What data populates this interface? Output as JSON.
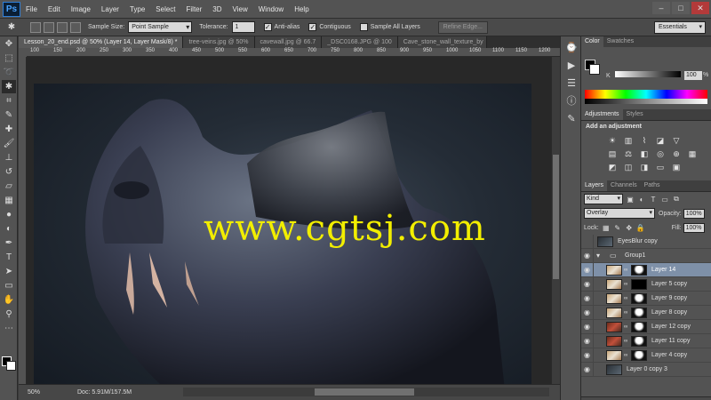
{
  "app": {
    "logo": "Ps"
  },
  "menu": [
    "File",
    "Edit",
    "Image",
    "Layer",
    "Type",
    "Select",
    "Filter",
    "3D",
    "View",
    "Window",
    "Help"
  ],
  "window_controls": [
    "–",
    "□",
    "✕"
  ],
  "options": {
    "sample_size_label": "Sample Size:",
    "sample_size_value": "Point Sample",
    "tolerance_label": "Tolerance:",
    "tolerance_value": "1",
    "anti_alias_label": "Anti-alias",
    "contiguous_label": "Contiguous",
    "sample_all_label": "Sample All Layers",
    "refine_edge_label": "Refine Edge...",
    "workspace_value": "Essentials"
  },
  "doc_tabs": [
    "Lesson_20_end.psd @ 50% (Layer 14, Layer Mask/8) *",
    "tree-veins.jpg @ 50%",
    "cavewall.jpg @ 66.7",
    "_DSC0168.JPG @ 100",
    "Cave_stone_wall_texture_by"
  ],
  "ruler_ticks": [
    "100",
    "150",
    "200",
    "250",
    "300",
    "350",
    "400",
    "450",
    "500",
    "550",
    "600",
    "650",
    "700",
    "750",
    "800",
    "850",
    "900",
    "950",
    "1000",
    "1050",
    "1100",
    "1150",
    "1200"
  ],
  "canvas": {
    "watermark": "www.cgtsj.com"
  },
  "status": {
    "zoom": "50%",
    "doc_size": "Doc: 5.91M/157.5M"
  },
  "panels": {
    "color_tabs": [
      "Color",
      "Swatches"
    ],
    "k_label": "K",
    "k_value": "100",
    "k_pct": "%",
    "adjust_tabs": [
      "Adjustments",
      "Styles"
    ],
    "adjust_title": "Add an adjustment",
    "layer_tabs": [
      "Layers",
      "Channels",
      "Paths"
    ],
    "kind_value": "Kind",
    "blend_mode": "Overlay",
    "opacity_label": "Opacity:",
    "opacity_value": "100%",
    "lock_label": "Lock:",
    "fill_label": "Fill:",
    "fill_value": "100%"
  },
  "layers": [
    {
      "name": "EyesBlur copy",
      "type": "smart",
      "visible": false
    },
    {
      "name": "Group1",
      "type": "group",
      "visible": true
    },
    {
      "name": "Layer 14",
      "type": "masked",
      "visible": true,
      "selected": true
    },
    {
      "name": "Layer 5 copy",
      "type": "masked",
      "visible": true
    },
    {
      "name": "Layer 9 copy",
      "type": "masked",
      "visible": true
    },
    {
      "name": "Layer 8 copy",
      "type": "masked",
      "visible": true
    },
    {
      "name": "Layer 12 copy",
      "type": "masked",
      "visible": true
    },
    {
      "name": "Layer 11 copy",
      "type": "masked",
      "visible": true
    },
    {
      "name": "Layer 4 copy",
      "type": "masked",
      "visible": true
    },
    {
      "name": "Layer 0 copy 3",
      "type": "plain",
      "visible": true
    }
  ]
}
